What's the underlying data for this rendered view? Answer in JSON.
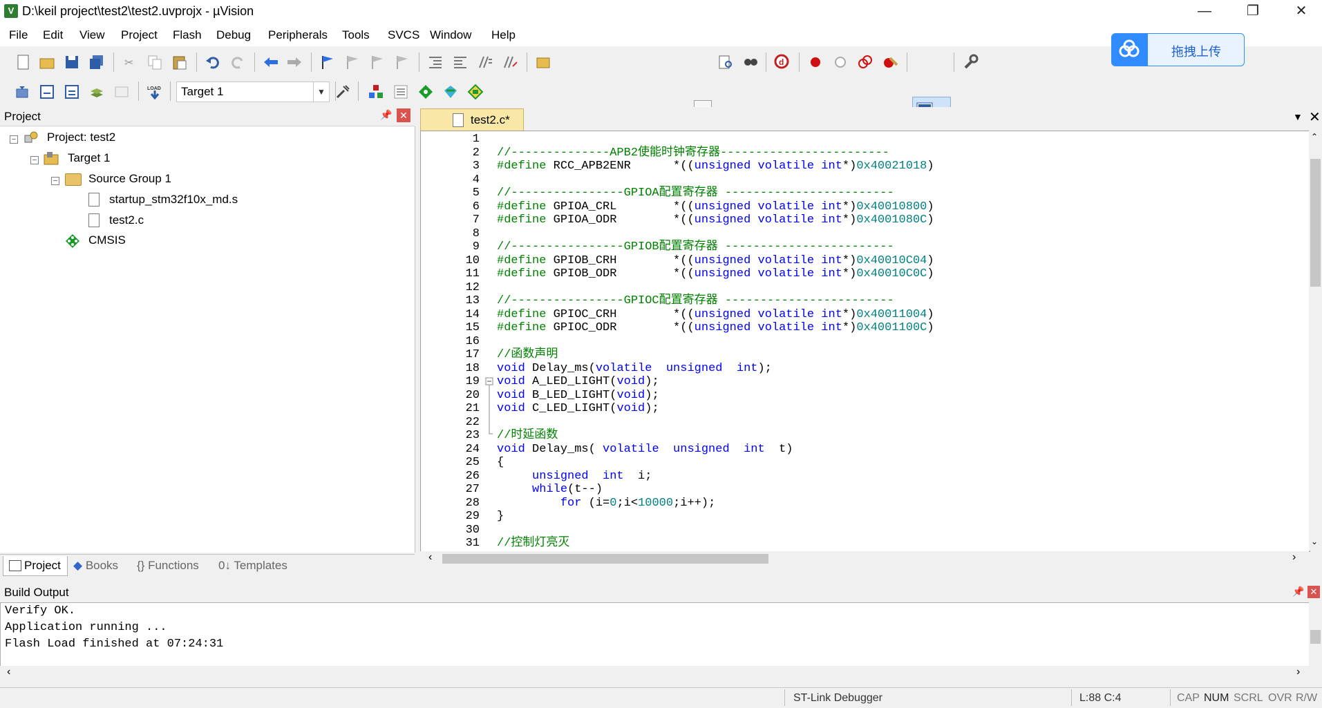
{
  "window": {
    "title": "D:\\keil project\\test2\\test2.uvprojx - µVision"
  },
  "menu": [
    "File",
    "Edit",
    "View",
    "Project",
    "Flash",
    "Debug",
    "Peripherals",
    "Tools",
    "SVCS",
    "Window",
    "Help"
  ],
  "upload": {
    "label": "拖拽上传"
  },
  "toolbar2": {
    "target": "Target 1"
  },
  "project": {
    "title": "Project",
    "tree": {
      "root": "Project: test2",
      "target": "Target 1",
      "group": "Source Group 1",
      "files": [
        "startup_stm32f10x_md.s",
        "test2.c"
      ],
      "cmsis": "CMSIS"
    },
    "tabs": [
      "Project",
      "Books",
      "{} Functions",
      "0↓ Templates"
    ]
  },
  "editor": {
    "tab": "test2.c*",
    "lines": [
      {
        "n": "1",
        "segs": []
      },
      {
        "n": "2",
        "segs": [
          [
            "cm",
            "//--------------APB2使能时钟寄存器------------------------"
          ]
        ]
      },
      {
        "n": "3",
        "segs": [
          [
            "cm",
            "#define"
          ],
          [
            "txt",
            " RCC_APB2ENR      *(("
          ],
          [
            "kw",
            "unsigned volatile int"
          ],
          [
            "txt",
            "*)"
          ],
          [
            "num",
            "0x40021018"
          ],
          [
            "txt",
            ")"
          ]
        ]
      },
      {
        "n": "4",
        "segs": []
      },
      {
        "n": "5",
        "segs": [
          [
            "cm",
            "//----------------GPIOA配置寄存器 ------------------------"
          ]
        ]
      },
      {
        "n": "6",
        "segs": [
          [
            "cm",
            "#define"
          ],
          [
            "txt",
            " GPIOA_CRL        *(("
          ],
          [
            "kw",
            "unsigned volatile int"
          ],
          [
            "txt",
            "*)"
          ],
          [
            "num",
            "0x40010800"
          ],
          [
            "txt",
            ")"
          ]
        ]
      },
      {
        "n": "7",
        "segs": [
          [
            "cm",
            "#define"
          ],
          [
            "txt",
            " GPIOA_ODR        *(("
          ],
          [
            "kw",
            "unsigned volatile int"
          ],
          [
            "txt",
            "*)"
          ],
          [
            "num",
            "0x4001080C"
          ],
          [
            "txt",
            ")"
          ]
        ]
      },
      {
        "n": "8",
        "segs": []
      },
      {
        "n": "9",
        "segs": [
          [
            "cm",
            "//----------------GPIOB配置寄存器 ------------------------"
          ]
        ]
      },
      {
        "n": "10",
        "segs": [
          [
            "cm",
            "#define"
          ],
          [
            "txt",
            " GPIOB_CRH        *(("
          ],
          [
            "kw",
            "unsigned volatile int"
          ],
          [
            "txt",
            "*)"
          ],
          [
            "num",
            "0x40010C04"
          ],
          [
            "txt",
            ")"
          ]
        ]
      },
      {
        "n": "11",
        "segs": [
          [
            "cm",
            "#define"
          ],
          [
            "txt",
            " GPIOB_ODR        *(("
          ],
          [
            "kw",
            "unsigned volatile int"
          ],
          [
            "txt",
            "*)"
          ],
          [
            "num",
            "0x40010C0C"
          ],
          [
            "txt",
            ")"
          ]
        ]
      },
      {
        "n": "12",
        "segs": []
      },
      {
        "n": "13",
        "segs": [
          [
            "cm",
            "//----------------GPIOC配置寄存器 ------------------------"
          ]
        ]
      },
      {
        "n": "14",
        "segs": [
          [
            "cm",
            "#define"
          ],
          [
            "txt",
            " GPIOC_CRH        *(("
          ],
          [
            "kw",
            "unsigned volatile int"
          ],
          [
            "txt",
            "*)"
          ],
          [
            "num",
            "0x40011004"
          ],
          [
            "txt",
            ")"
          ]
        ]
      },
      {
        "n": "15",
        "segs": [
          [
            "cm",
            "#define"
          ],
          [
            "txt",
            " GPIOC_ODR        *(("
          ],
          [
            "kw",
            "unsigned volatile int"
          ],
          [
            "txt",
            "*)"
          ],
          [
            "num",
            "0x4001100C"
          ],
          [
            "txt",
            ")"
          ]
        ]
      },
      {
        "n": "16",
        "segs": []
      },
      {
        "n": "17",
        "segs": [
          [
            "cm",
            "//函数声明"
          ]
        ]
      },
      {
        "n": "18",
        "segs": [
          [
            "kw",
            "void"
          ],
          [
            "txt",
            " Delay_ms("
          ],
          [
            "kw",
            "volatile  unsigned  int"
          ],
          [
            "txt",
            ");"
          ]
        ]
      },
      {
        "n": "19",
        "segs": [
          [
            "kw",
            "void"
          ],
          [
            "txt",
            " A_LED_LIGHT("
          ],
          [
            "kw",
            "void"
          ],
          [
            "txt",
            ");"
          ]
        ]
      },
      {
        "n": "20",
        "segs": [
          [
            "kw",
            "void"
          ],
          [
            "txt",
            " B_LED_LIGHT("
          ],
          [
            "kw",
            "void"
          ],
          [
            "txt",
            ");"
          ]
        ]
      },
      {
        "n": "21",
        "segs": [
          [
            "kw",
            "void"
          ],
          [
            "txt",
            " C_LED_LIGHT("
          ],
          [
            "kw",
            "void"
          ],
          [
            "txt",
            ");"
          ]
        ]
      },
      {
        "n": "22",
        "segs": []
      },
      {
        "n": "23",
        "segs": [
          [
            "cm",
            "//时延函数"
          ]
        ]
      },
      {
        "n": "24",
        "segs": [
          [
            "kw",
            "void"
          ],
          [
            "txt",
            " Delay_ms( "
          ],
          [
            "kw",
            "volatile  unsigned  int"
          ],
          [
            "txt",
            "  t)"
          ]
        ]
      },
      {
        "n": "25",
        "segs": [
          [
            "txt",
            "{"
          ]
        ]
      },
      {
        "n": "26",
        "segs": [
          [
            "txt",
            "     "
          ],
          [
            "kw",
            "unsigned  int"
          ],
          [
            "txt",
            "  i;"
          ]
        ]
      },
      {
        "n": "27",
        "segs": [
          [
            "txt",
            "     "
          ],
          [
            "kw",
            "while"
          ],
          [
            "txt",
            "(t--)"
          ]
        ]
      },
      {
        "n": "28",
        "segs": [
          [
            "txt",
            "         "
          ],
          [
            "kw",
            "for"
          ],
          [
            "txt",
            " (i="
          ],
          [
            "num",
            "0"
          ],
          [
            "txt",
            ";i<"
          ],
          [
            "num",
            "10000"
          ],
          [
            "txt",
            ";i++);"
          ]
        ]
      },
      {
        "n": "29",
        "segs": [
          [
            "txt",
            "}"
          ]
        ]
      },
      {
        "n": "30",
        "segs": []
      },
      {
        "n": "31",
        "segs": [
          [
            "cm",
            "//控制灯亮灭"
          ]
        ]
      }
    ]
  },
  "build": {
    "title": "Build Output",
    "lines": [
      "Verify OK.",
      "Application running ...",
      "Flash Load finished at 07:24:31"
    ]
  },
  "status": {
    "debugger": "ST-Link Debugger",
    "position": "L:88 C:4",
    "cap": "CAP",
    "num": "NUM",
    "scrl": "SCRL",
    "ovr": "OVR",
    "rw": "R/W"
  }
}
